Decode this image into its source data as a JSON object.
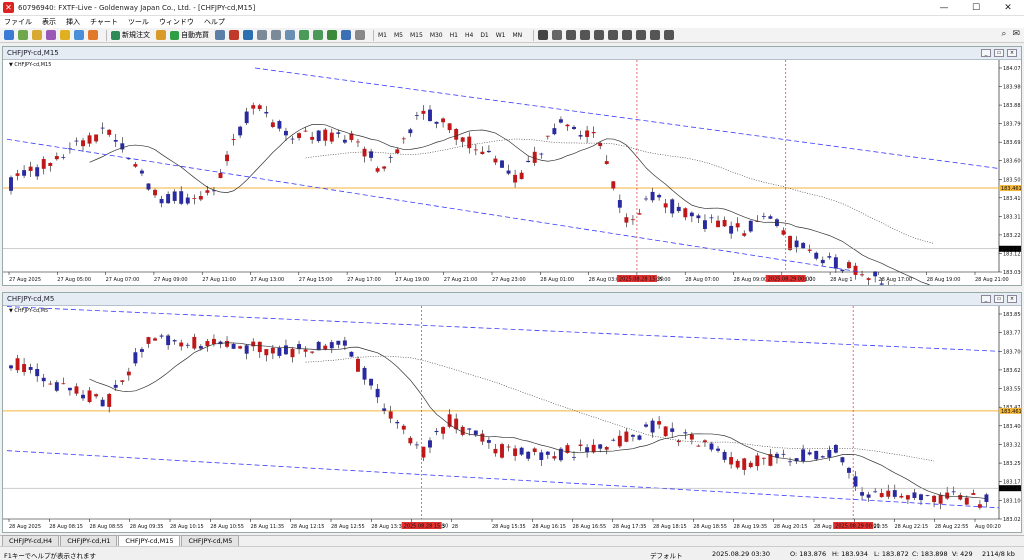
{
  "window": {
    "title": "60796940: FXTF-Live - Goldenway Japan Co., Ltd. - [CHFJPY-cd,M15]",
    "controls": [
      "—",
      "☐",
      "✕"
    ]
  },
  "menu": [
    "ファイル",
    "表示",
    "挿入",
    "チャート",
    "ツール",
    "ウィンドウ",
    "ヘルプ"
  ],
  "toolbar": {
    "new_order": "新規注文",
    "auto_trade": "自動売買",
    "timeframes": [
      "M1",
      "M5",
      "M15",
      "M30",
      "H1",
      "H4",
      "D1",
      "W1",
      "MN"
    ]
  },
  "colors": {
    "bull": "#2a2aa0",
    "bear": "#c01818",
    "channel": "#3a3aff",
    "hline": "#f3b63a",
    "vline": "#e03030",
    "ma": "#333333"
  },
  "charts": [
    {
      "window_title": "CHFJPY-cd,M15",
      "label": "CHFJPY-cd,M15",
      "price_labels": [
        "184.075",
        "183.980",
        "183.885",
        "183.790",
        "183.695",
        "183.600",
        "183.505",
        "183.410",
        "183.315",
        "183.220",
        "183.125",
        "183.030"
      ],
      "price_min": 183.03,
      "price_max": 184.075,
      "hline_value": 183.46,
      "hline_label": "183.461",
      "current_price": "183.149",
      "time_labels": [
        "27 Aug 2025",
        "27 Aug 05:00",
        "27 Aug 07:00",
        "27 Aug 09:00",
        "27 Aug 11:00",
        "27 Aug 13:00",
        "27 Aug 15:00",
        "27 Aug 17:00",
        "27 Aug 19:00",
        "27 Aug 21:00",
        "27 Aug 23:00",
        "28 Aug 01:00",
        "28 Aug 03:00",
        "28 Aug 05:00",
        "28 Aug 07:00",
        "28 Aug 09:00",
        "28 Aug 11:00",
        "28 Aug 1",
        "28 Aug 17:00",
        "28 Aug 19:00",
        "28 Aug 21:00"
      ],
      "vline_labels": [
        "2025.08.28 15:30",
        "2025.08.29 00:00"
      ]
    },
    {
      "window_title": "CHFJPY-cd,M5",
      "label": "CHFJPY-cd,M5",
      "price_labels": [
        "183.850",
        "183.775",
        "183.700",
        "183.625",
        "183.550",
        "183.475",
        "183.400",
        "183.325",
        "183.250",
        "183.175",
        "183.100",
        "183.025"
      ],
      "price_min": 183.025,
      "price_max": 183.85,
      "hline_value": 183.46,
      "hline_label": "183.461",
      "current_price": "183.149",
      "time_labels": [
        "28 Aug 2025",
        "28 Aug 08:15",
        "28 Aug 08:55",
        "28 Aug 09:35",
        "28 Aug 10:15",
        "28 Aug 10:55",
        "28 Aug 11:35",
        "28 Aug 12:15",
        "28 Aug 12:55",
        "28 Aug 13:35",
        "28 Aug 14:15",
        "28",
        "28 Aug 15:35",
        "28 Aug 16:15",
        "28 Aug 16:55",
        "28 Aug 17:35",
        "28 Aug 18:15",
        "28 Aug 18:55",
        "28 Aug 19:35",
        "28 Aug 20:15",
        "28 Aug 20:55",
        "28 Aug 21:35",
        "28 Aug 22:15",
        "28 Aug 22:55",
        "Aug 00:20"
      ],
      "vline_labels": [
        "2025.08.28 15:30",
        "2025.08.29 00:00"
      ]
    }
  ],
  "tabs": [
    "CHFJPY-cd,H4",
    "CHFJPY-cd,H1",
    "CHFJPY-cd,M15",
    "CHFJPY-cd,M5"
  ],
  "active_tab": "CHFJPY-cd,M15",
  "status": {
    "help": "F1キーでヘルプが表示されます",
    "profile": "デフォルト",
    "datetime": "2025.08.29 03:30",
    "open": "O: 183.876",
    "high": "H: 183.934",
    "low": "L: 183.872",
    "close": "C: 183.898",
    "volume": "V: 429",
    "connection": "2114/8 kb"
  }
}
